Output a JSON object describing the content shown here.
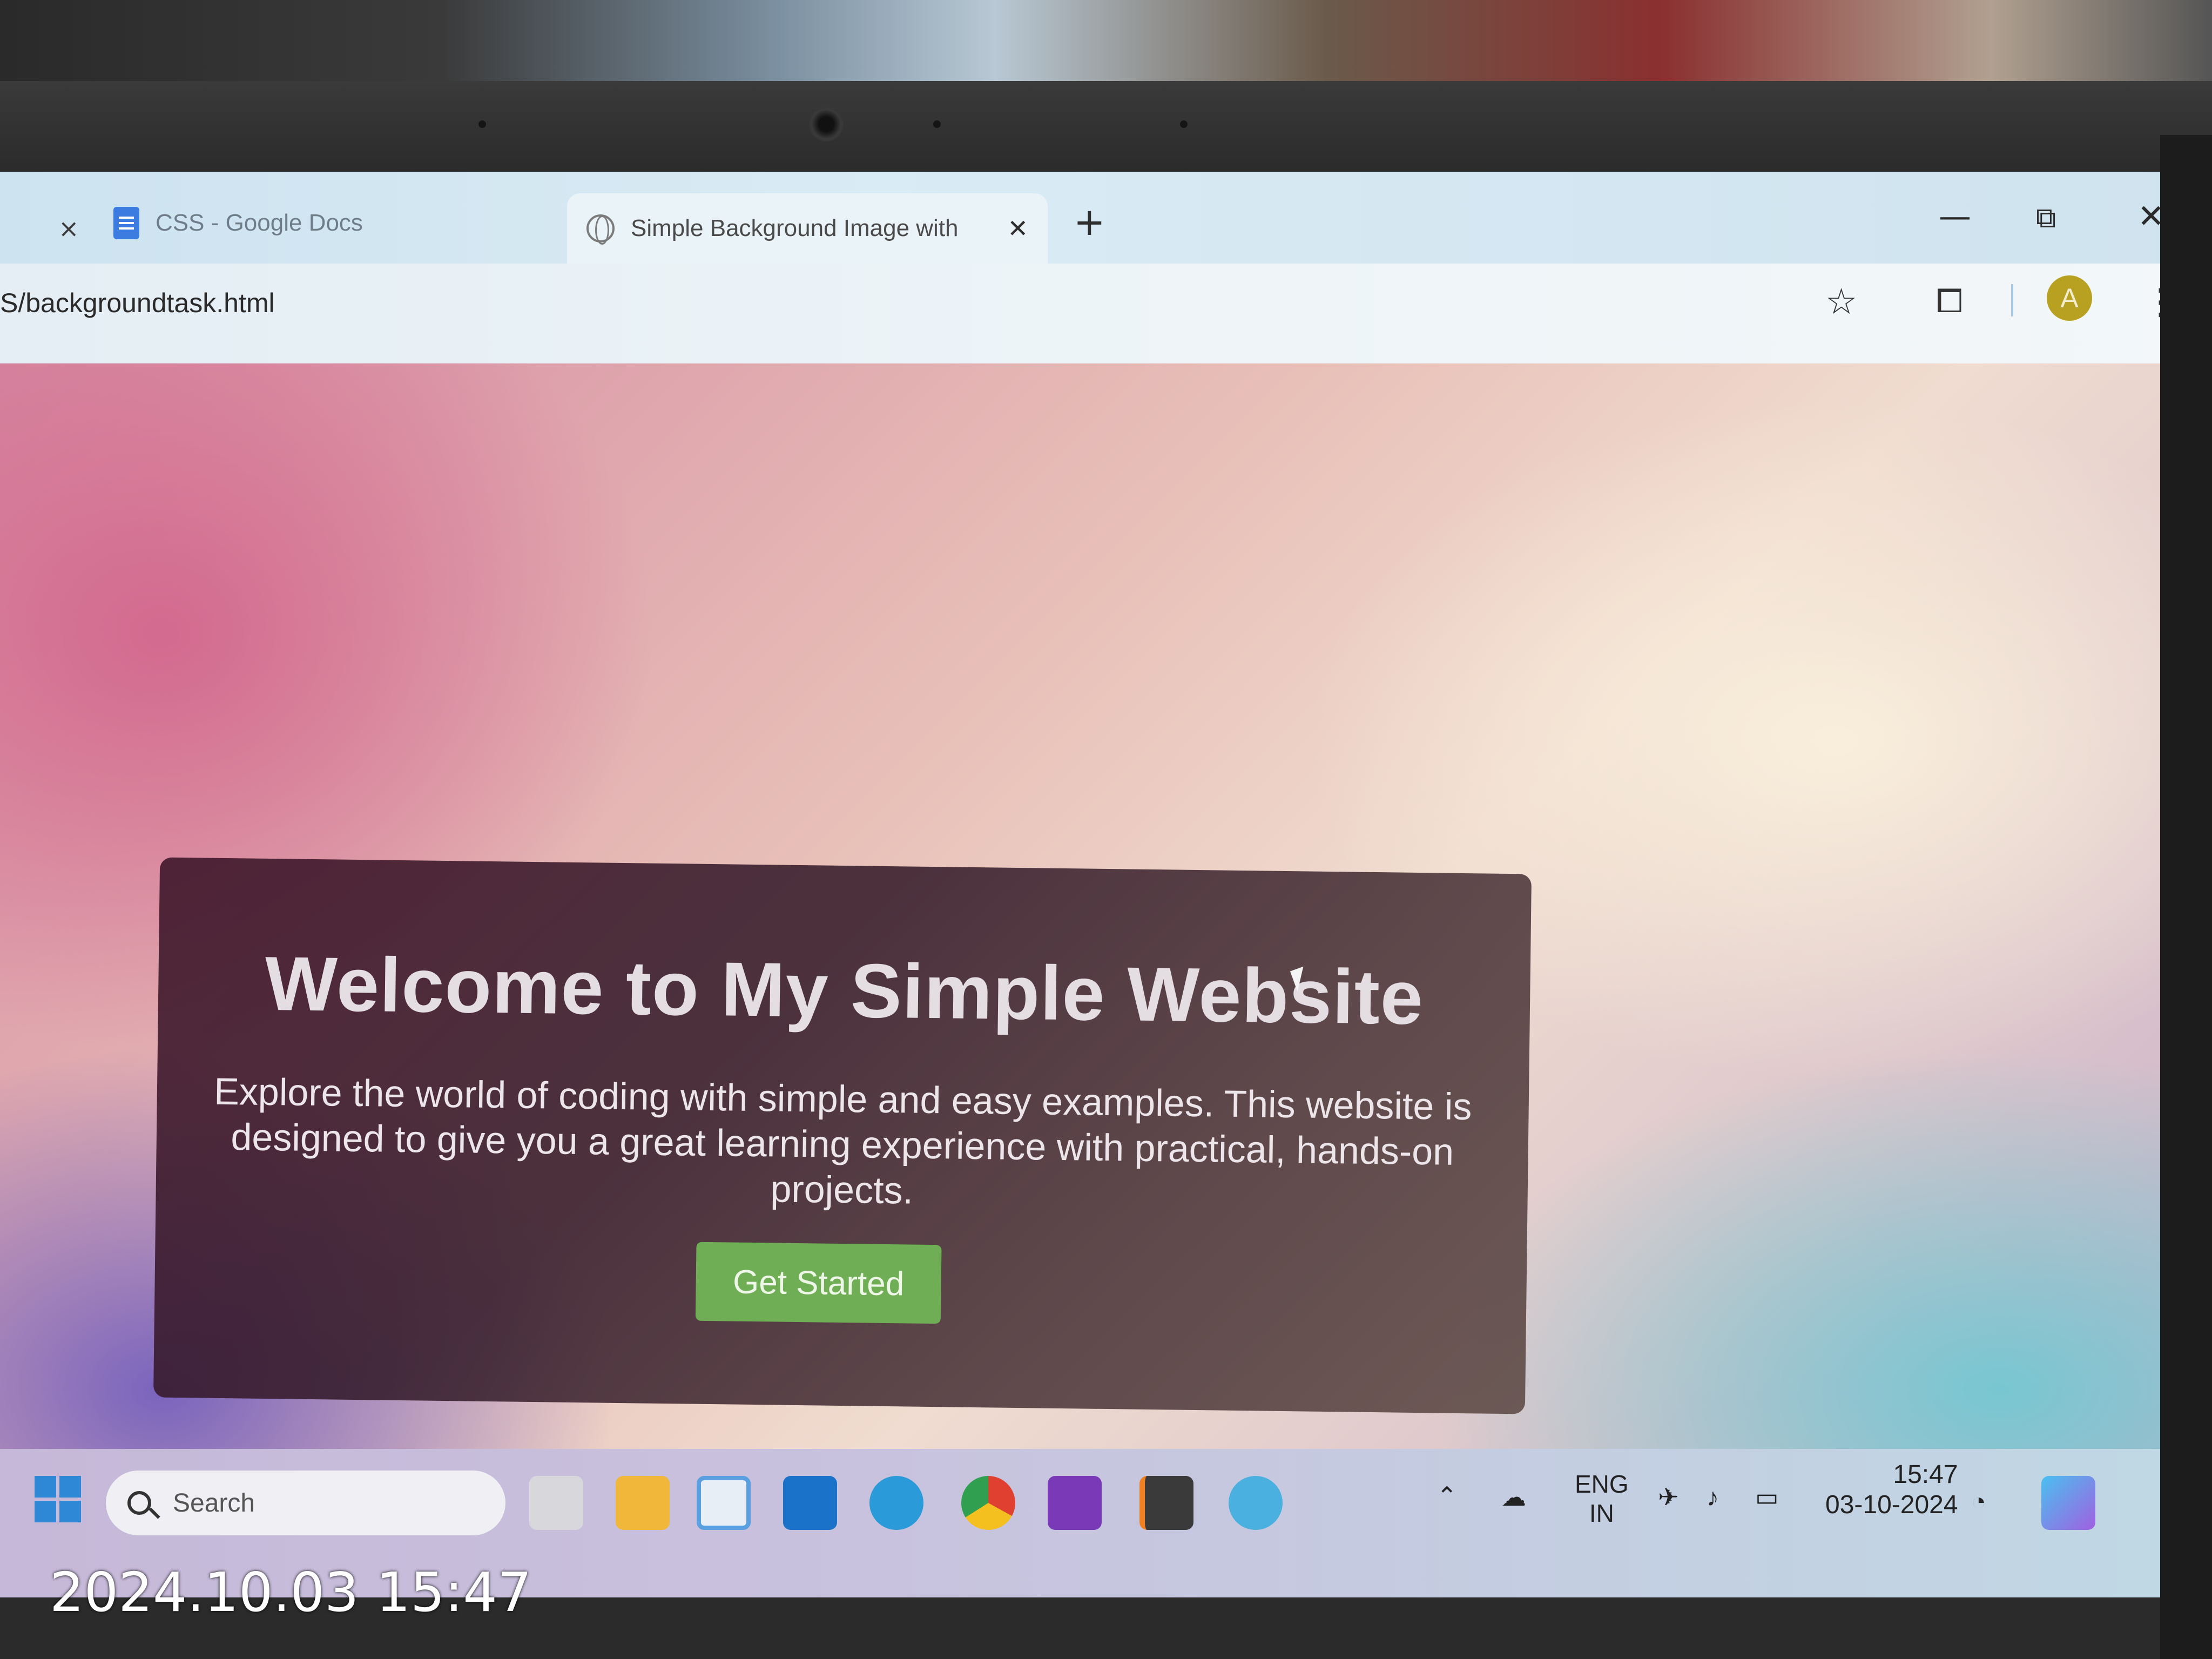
{
  "browser": {
    "tabs": [
      {
        "label": "CSS - Google Docs",
        "close": "×"
      },
      {
        "label": "Simple Background Image with",
        "close": "✕",
        "active": true
      }
    ],
    "new_tab": "+",
    "window_controls": {
      "minimize": "—",
      "restore": "⧉",
      "close": "✕"
    },
    "url": "S/backgroundtask.html",
    "profile_initial": "A",
    "icons": [
      "star-icon",
      "extensions-icon",
      "more-vert-icon"
    ]
  },
  "page": {
    "title": "Welcome to My Simple Website",
    "description": "Explore the world of coding with simple and easy examples. This website is designed to give you a great learning experience with practical, hands-on projects.",
    "button": "Get Started",
    "button_color": "#6fae55"
  },
  "taskbar": {
    "search_placeholder": "Search",
    "language": "ENG",
    "region": "IN",
    "time": "15:47",
    "date": "03-10-2024"
  },
  "photo_timestamp": "2024.10.03 15:47"
}
